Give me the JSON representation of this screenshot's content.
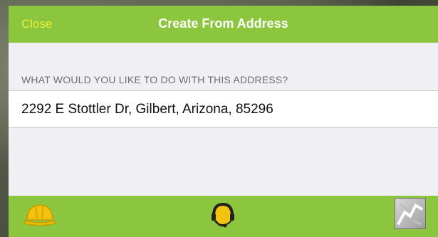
{
  "navbar": {
    "close_label": "Close",
    "title": "Create From Address"
  },
  "content": {
    "section_header": "WHAT WOULD YOU LIKE TO DO WITH THIS ADDRESS?",
    "address": "2292 E Stottler Dr, Gilbert, Arizona, 85296"
  },
  "tabbar": {
    "icons": [
      "hard-hat-icon",
      "headset-icon",
      "map-thumbnail-icon"
    ]
  },
  "colors": {
    "bar_green": "#8cc63f",
    "close_yellow": "#e7ef3a",
    "icon_yellow": "#f2c20f",
    "background": "#efeff4"
  }
}
